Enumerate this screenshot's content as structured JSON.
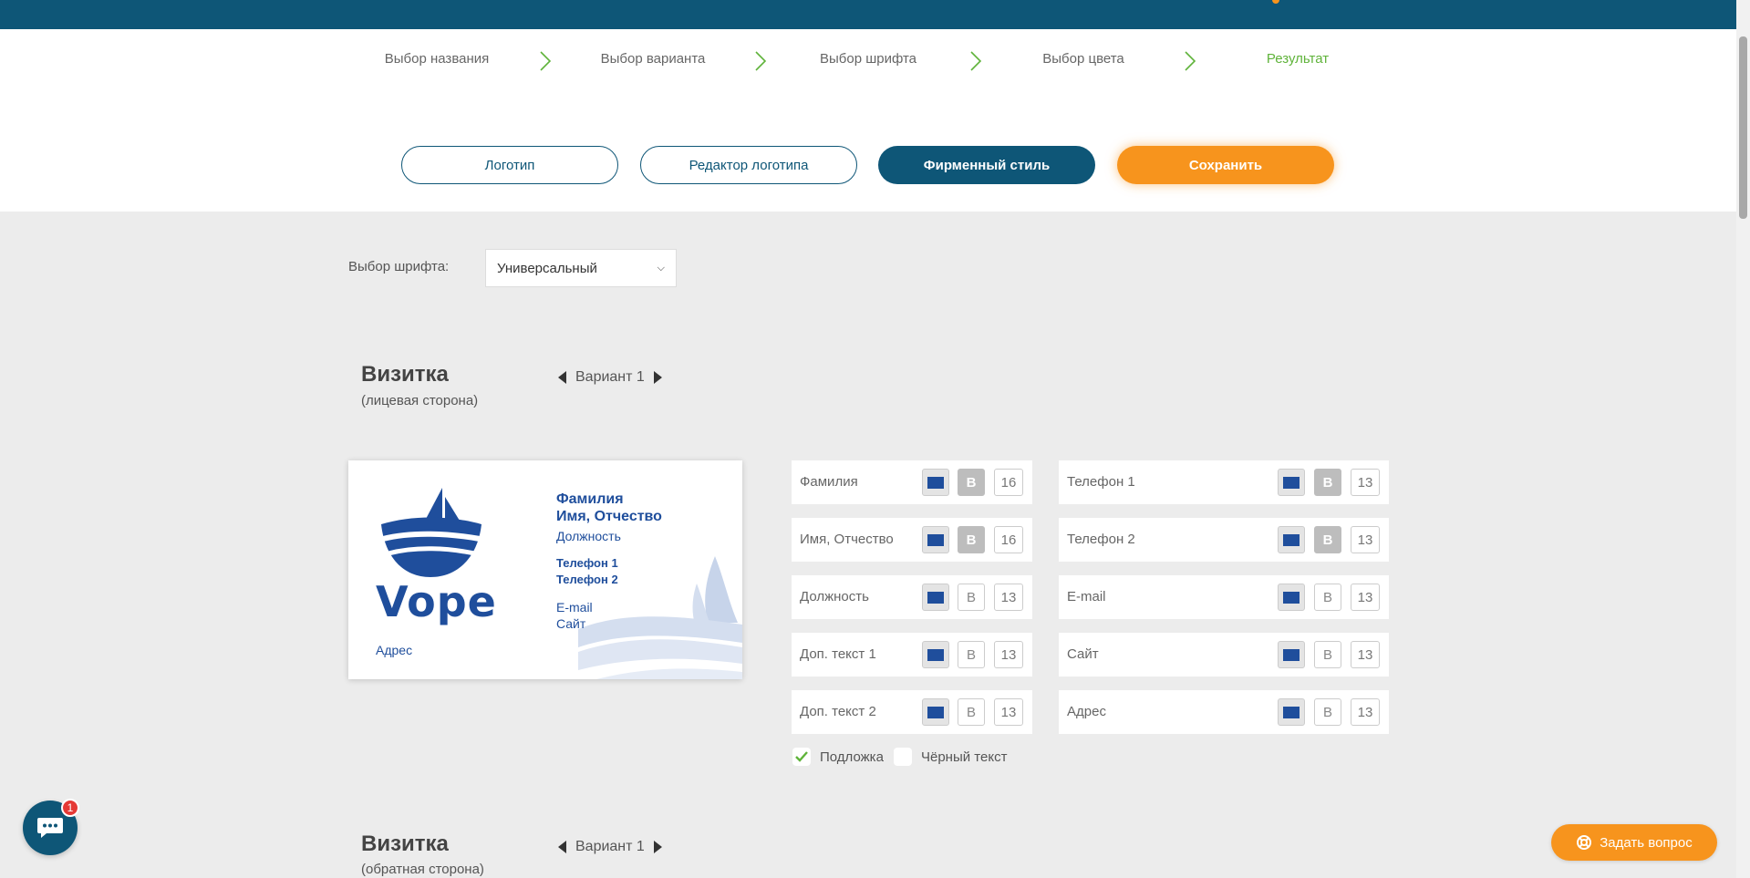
{
  "steps": [
    "Выбор названия",
    "Выбор варианта",
    "Выбор шрифта",
    "Выбор цвета",
    "Результат"
  ],
  "tabs": {
    "logo": "Логотип",
    "editor": "Редактор логотипа",
    "brand": "Фирменный стиль",
    "save": "Сохранить"
  },
  "font_select": {
    "label": "Выбор шрифта:",
    "value": "Универсальный"
  },
  "front": {
    "title": "Визитка",
    "subtitle": "(лицевая сторона)",
    "variant": "Вариант 1"
  },
  "back": {
    "title": "Визитка",
    "subtitle": "(обратная сторона)",
    "variant": "Вариант 1"
  },
  "card": {
    "logo_text": "Vope",
    "surname": "Фамилия",
    "name": "Имя, Отчество",
    "position": "Должность",
    "phone1": "Телефон 1",
    "phone2": "Телефон 2",
    "email": "E-mail",
    "site": "Сайт",
    "address": "Адрес",
    "accent_color": "#1f4e9c"
  },
  "fields_left": [
    {
      "label": "Фамилия",
      "bold": true,
      "size": "16"
    },
    {
      "label": "Имя, Отчество",
      "bold": true,
      "size": "16"
    },
    {
      "label": "Должность",
      "bold": false,
      "size": "13"
    },
    {
      "label": "Доп. текст 1",
      "bold": false,
      "size": "13"
    },
    {
      "label": "Доп. текст 2",
      "bold": false,
      "size": "13"
    }
  ],
  "fields_right": [
    {
      "label": "Телефон 1",
      "bold": true,
      "size": "13"
    },
    {
      "label": "Телефон 2",
      "bold": true,
      "size": "13"
    },
    {
      "label": "E-mail",
      "bold": false,
      "size": "13"
    },
    {
      "label": "Сайт",
      "bold": false,
      "size": "13"
    },
    {
      "label": "Адрес",
      "bold": false,
      "size": "13"
    }
  ],
  "bold_glyph": "B",
  "checkboxes": {
    "underlay": {
      "label": "Подложка",
      "checked": true
    },
    "black_text": {
      "label": "Чёрный текст",
      "checked": false
    }
  },
  "chat": {
    "badge": "1"
  },
  "ask_button": "Задать вопрос",
  "colors": {
    "brand": "#0e5677",
    "accent": "#f7941d",
    "active_step": "#5fb33a"
  }
}
